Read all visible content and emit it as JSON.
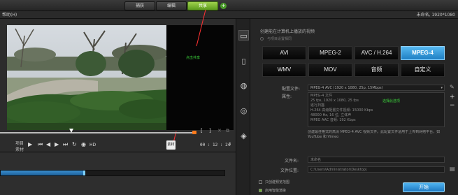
{
  "tabs": [
    {
      "label": "捕获"
    },
    {
      "label": "编辑"
    },
    {
      "label": "共享"
    }
  ],
  "menu": {
    "help": "帮助(H)"
  },
  "project": {
    "info": "未命名, 1920*1080"
  },
  "annotations": {
    "click_share": "点击共享",
    "select_format": "选择此选项"
  },
  "player": {
    "snap_label": "项目",
    "clip_label": "素材",
    "hd_label": "HD",
    "timecode": "00 : 12 : 24"
  },
  "share": {
    "heading": "创建能在计算机上播放的视频",
    "sub_option": "与项目设置相同",
    "formats": [
      "AVI",
      "MPEG-2",
      "AVC / H.264",
      "MPEG-4",
      "WMV",
      "MOV",
      "音频",
      "自定义"
    ],
    "selected_format": "MPEG-4",
    "profile_label": "配置文件:",
    "profile_value": "MPEG-4 AVC (1920 x 1080, 25p, 15Mbps)",
    "properties_label": "属性:",
    "properties_lines": [
      "MPEG-4 文件",
      "25 fps, 1920 x 1080, 25 fps",
      "逐行扫描",
      "H.264 高级配置文件视频: 15000 Kbps",
      "48000 Hz, 16 位, 立体声",
      "MPEG AAC 音频: 192 Kbps"
    ],
    "description": "创建最佳格式的高清 MPEG-4 AVC 视频文件。此配置文件适用于上传到网络平台，如 YouTube 和 Vimeo",
    "filename_label": "文件名:",
    "filename_value": "未命名",
    "location_label": "文件位置:",
    "location_value": "C:\\Users\\Administrator\\Desktop\\",
    "checkbox1_label": "只创建预览范围",
    "checkbox2_label": "启用智能渲染",
    "start_label": "开始"
  },
  "colors": {
    "accent_green": "#6fb52c",
    "accent_blue": "#2a8fd8",
    "annotation_red": "#ff3232"
  }
}
